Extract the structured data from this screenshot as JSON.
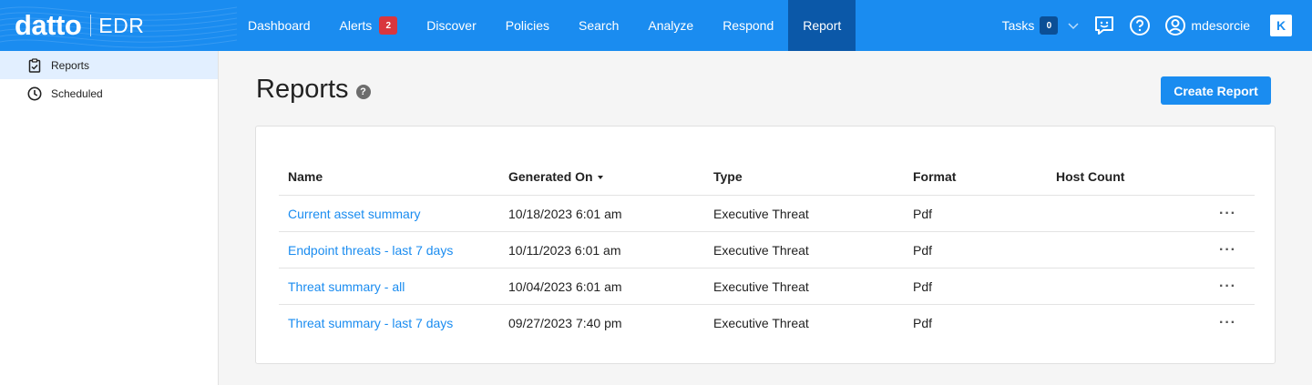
{
  "brand": {
    "name": "datto",
    "product": "EDR"
  },
  "nav": {
    "items": [
      {
        "label": "Dashboard"
      },
      {
        "label": "Alerts",
        "badge": "2"
      },
      {
        "label": "Discover"
      },
      {
        "label": "Policies"
      },
      {
        "label": "Search"
      },
      {
        "label": "Analyze"
      },
      {
        "label": "Respond"
      },
      {
        "label": "Report",
        "active": true
      }
    ]
  },
  "tools": {
    "tasks_label": "Tasks",
    "tasks_count": "0",
    "username": "mdesorcie",
    "kaseya_glyph": "K"
  },
  "sidebar": {
    "items": [
      {
        "label": "Reports",
        "icon": "clipboard-check-icon",
        "active": true
      },
      {
        "label": "Scheduled",
        "icon": "clock-icon"
      }
    ]
  },
  "page": {
    "title": "Reports",
    "help_glyph": "?",
    "create_button": "Create Report"
  },
  "table": {
    "columns": {
      "name": "Name",
      "generated_on": "Generated On",
      "type": "Type",
      "format": "Format",
      "host_count": "Host Count"
    },
    "rows": [
      {
        "name": "Current asset summary",
        "generated_on": "10/18/2023 6:01 am",
        "type": "Executive Threat",
        "format": "Pdf",
        "host_count": ""
      },
      {
        "name": "Endpoint threats - last 7 days",
        "generated_on": "10/11/2023 6:01 am",
        "type": "Executive Threat",
        "format": "Pdf",
        "host_count": ""
      },
      {
        "name": "Threat summary - all",
        "generated_on": "10/04/2023 6:01 am",
        "type": "Executive Threat",
        "format": "Pdf",
        "host_count": ""
      },
      {
        "name": "Threat summary - last 7 days",
        "generated_on": "09/27/2023 7:40 pm",
        "type": "Executive Threat",
        "format": "Pdf",
        "host_count": ""
      }
    ],
    "row_action_glyph": "···"
  },
  "colors": {
    "primary": "#1a8cf0",
    "nav_active": "#0b58a8",
    "alert_badge": "#d9363e",
    "sidebar_active": "#e2efff"
  }
}
